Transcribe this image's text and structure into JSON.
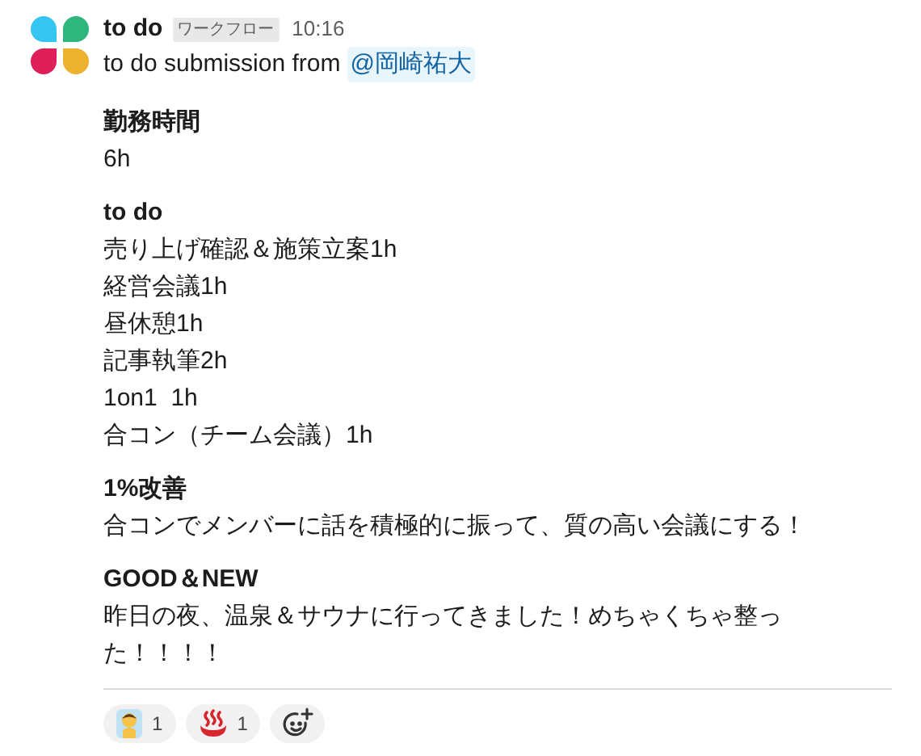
{
  "message": {
    "sender": "to do",
    "badge": "ワークフロー",
    "time": "10:16",
    "intro": "to do submission from",
    "mention": "@岡崎祐大"
  },
  "sections": [
    {
      "title": "勤務時間",
      "lines": [
        "6h"
      ]
    },
    {
      "title": "to do",
      "lines": [
        "売り上げ確認＆施策立案1h",
        "経営会議1h",
        "昼休憩1h",
        "記事執筆2h",
        "1on1  1h",
        "合コン（チーム会議）1h"
      ]
    },
    {
      "title": "1%改善",
      "lines": [
        "合コンでメンバーに話を積極的に振って、質の高い会議にする！"
      ]
    },
    {
      "title": "GOOD＆NEW",
      "lines": [
        "昨日の夜、温泉＆サウナに行ってきました！めちゃくちゃ整った！！！！"
      ]
    }
  ],
  "reactions": [
    {
      "kind": "sauna",
      "count": "1"
    },
    {
      "kind": "hot-springs",
      "count": "1"
    }
  ]
}
